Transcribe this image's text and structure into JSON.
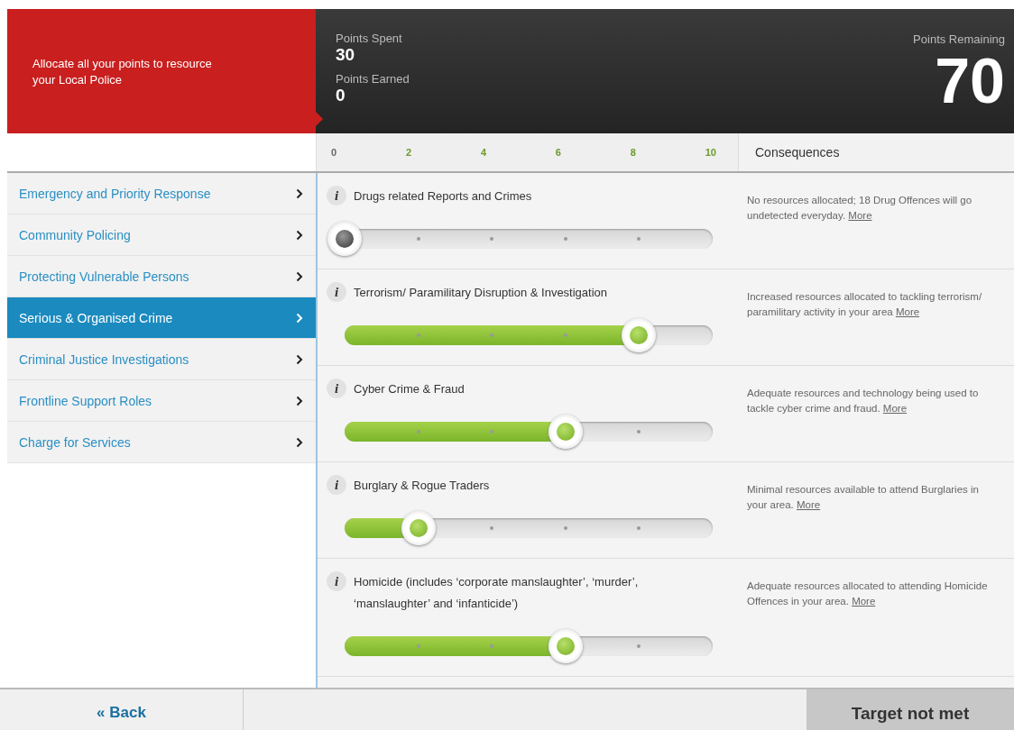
{
  "header": {
    "instruction": "Allocate all your points to resource your Local Police",
    "points_spent_label": "Points Spent",
    "points_spent": "30",
    "points_earned_label": "Points Earned",
    "points_earned": "0",
    "points_remaining_label": "Points Remaining",
    "points_remaining": "70"
  },
  "scale": {
    "ticks": [
      "0",
      "2",
      "4",
      "6",
      "8",
      "10"
    ],
    "consequences_heading": "Consequences"
  },
  "sidebar": {
    "items": [
      {
        "label": "Emergency and Priority Response",
        "selected": false
      },
      {
        "label": "Community Policing",
        "selected": false
      },
      {
        "label": "Protecting Vulnerable Persons",
        "selected": false
      },
      {
        "label": "Serious & Organised Crime",
        "selected": true
      },
      {
        "label": "Criminal Justice Investigations",
        "selected": false
      },
      {
        "label": "Frontline Support Roles",
        "selected": false
      },
      {
        "label": "Charge for Services",
        "selected": false
      }
    ]
  },
  "allocations": [
    {
      "info": "i",
      "title": "Drugs related Reports and Crimes",
      "level": 0,
      "consequence": "No resources allocated; 18 Drug Offences will go undetected everyday.",
      "link": "More"
    },
    {
      "info": "i",
      "title": "Terrorism/ Paramilitary Disruption & Investigation",
      "level": 0.8,
      "consequence": "Increased resources allocated to tackling terrorism/ paramilitary activity in your area",
      "link": "More"
    },
    {
      "info": "i",
      "title": "Cyber Crime & Fraud",
      "level": 0.6,
      "consequence": "Adequate resources and technology being used to tackle cyber crime and fraud.",
      "link": "More"
    },
    {
      "info": "i",
      "title": "Burglary & Rogue Traders",
      "level": 0.2,
      "consequence": "Minimal resources available to attend Burglaries in your area.",
      "link": "More"
    },
    {
      "info": "i",
      "title": "Homicide (includes ‘corporate manslaughter’, ‘murder’, ‘manslaughter’ and ‘infanticide’)",
      "level": 0.6,
      "consequence": "Adequate resources allocated to attending Homicide Offences in your area.",
      "link": "More"
    }
  ],
  "footer": {
    "back": "« Back",
    "status": "Target not met"
  }
}
